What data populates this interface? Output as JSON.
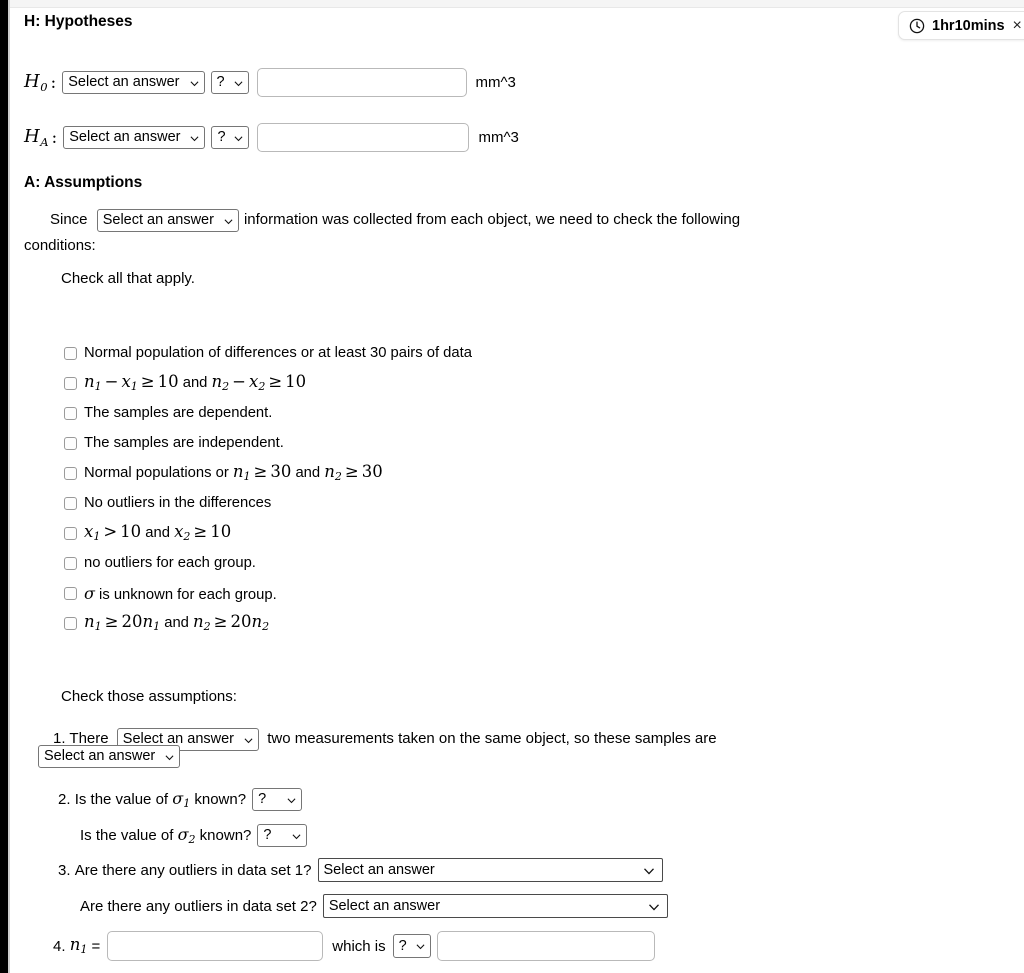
{
  "timer": {
    "icon": "clock-icon",
    "label": "1hr10mins",
    "close": "×"
  },
  "hypotheses": {
    "heading": "H: Hypotheses",
    "rows": [
      {
        "symbol": "H",
        "subscript": "0",
        "colon": ":",
        "select_label": "Select an answer",
        "comparator_label": "?",
        "value": "",
        "unit": "mm^3"
      },
      {
        "symbol": "H",
        "subscript": "A",
        "colon": ":",
        "select_label": "Select an answer",
        "comparator_label": "?",
        "value": "",
        "unit": "mm^3"
      }
    ]
  },
  "assumptions": {
    "heading": "A: Assumptions",
    "since_prefix": "Since",
    "since_select_label": "Select an answer",
    "since_suffix": "information was collected from each object, we need to check the following",
    "since_line2": "conditions:",
    "check_all_text": "Check all that apply.",
    "checkboxes": [
      {
        "id": "normal-population-differences",
        "text": "Normal population of differences or at least 30 pairs of data",
        "math": false
      },
      {
        "id": "n1-minus-x1",
        "text": "n1 − x1 ≥ 10 and n2 − x2 ≥ 10",
        "math": true
      },
      {
        "id": "samples-dependent",
        "text": "The samples are dependent.",
        "math": false
      },
      {
        "id": "samples-independent",
        "text": "The samples are independent.",
        "math": false
      },
      {
        "id": "normal-populations-n30",
        "text": "Normal populations or n1 ≥ 30 and n2 ≥ 30",
        "math": true
      },
      {
        "id": "no-outliers-differences",
        "text": "No outliers in the differences",
        "math": false
      },
      {
        "id": "x1-gt-10",
        "text": "x1 > 10 and x2 ≥ 10",
        "math": true
      },
      {
        "id": "no-outliers-each-group",
        "text": "no outliers for each group.",
        "math": false
      },
      {
        "id": "sigma-unknown",
        "text": "σ is unknown for each group.",
        "math": true
      },
      {
        "id": "n1-ge-20n1",
        "text": "n1 ≥ 20n1 and n2 ≥ 20n2",
        "math": true
      }
    ]
  },
  "check_assumptions": {
    "heading": "Check those assumptions:",
    "q1": {
      "number": "1.",
      "prefix": "There",
      "select1_label": "Select an answer",
      "middle": "two measurements taken on the same object, so these samples are",
      "select2_label": "Select an answer"
    },
    "q2": {
      "number": "2.",
      "line1": "Is the value of",
      "line1_sigma_sub": "1",
      "line1_suffix": "known?",
      "line1_select": "?",
      "line2": "Is the value of",
      "line2_sigma_sub": "2",
      "line2_suffix": "known?",
      "line2_select": "?"
    },
    "q3": {
      "number": "3.",
      "line1": "Are there any outliers in data set 1?",
      "line1_select": "Select an answer",
      "line2": "Are there any outliers in data set 2?",
      "line2_select": "Select an answer"
    },
    "q4": {
      "number": "4.",
      "var": "n",
      "var_sub": "1",
      "equals": "=",
      "value1": "",
      "which_is": "which is",
      "select_label": "?",
      "value2": ""
    }
  },
  "colors": {
    "border": "#767676",
    "input_border": "#b9b9b9",
    "rail": "#000000"
  }
}
